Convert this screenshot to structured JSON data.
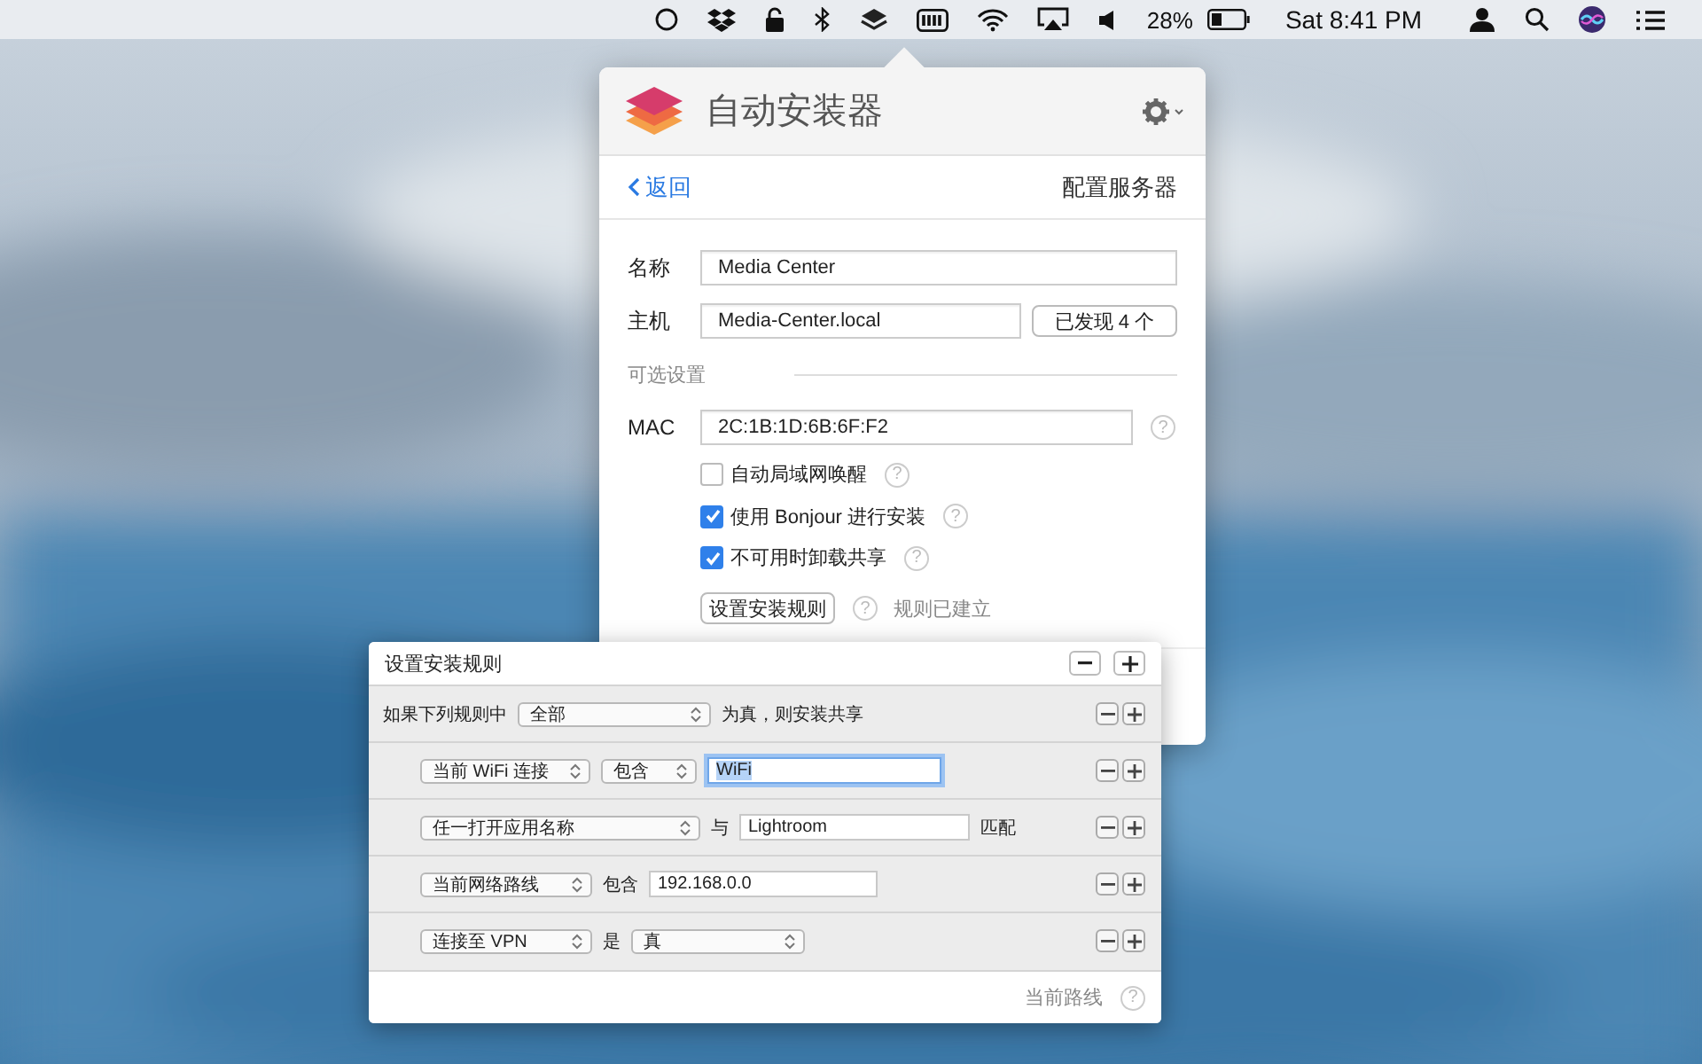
{
  "menubar": {
    "battery": "28%",
    "clock": "Sat 8:41 PM"
  },
  "popover": {
    "title": "自动安装器",
    "back": "返回",
    "heading": "配置服务器",
    "fields": [
      {
        "label": "名称",
        "value": "Media Center"
      },
      {
        "label": "主机",
        "value": "Media-Center.local",
        "button": "已发现 4 个"
      }
    ],
    "section": "可选设置",
    "mac": {
      "label": "MAC",
      "value": "2C:1B:1D:6B:6F:F2",
      "help": "?"
    },
    "options": [
      {
        "label": "自动局域网唤醒",
        "checked": false,
        "help": "?"
      },
      {
        "label": "使用 Bonjour 进行安装",
        "checked": true,
        "help": "?"
      },
      {
        "label": "不可用时卸载共享",
        "checked": true,
        "help": "?"
      }
    ],
    "rules_button": "设置安装规则",
    "rules_help": "?",
    "rules_status": "规则已建立"
  },
  "rules_sheet": {
    "title": "设置安装规则",
    "header": {
      "prefix": "如果下列规则中",
      "popup": "全部",
      "suffix": "为真，则安装共享"
    },
    "rules": [
      {
        "parts": [
          {
            "kind": "popup",
            "text": "当前 WiFi 连接"
          },
          {
            "kind": "popup",
            "text": "包含"
          },
          {
            "kind": "field",
            "text": "WiFi",
            "focused": true
          }
        ]
      },
      {
        "parts": [
          {
            "kind": "popup",
            "text": "任一打开应用名称"
          },
          {
            "kind": "label",
            "text": "与"
          },
          {
            "kind": "field",
            "text": "Lightroom",
            "focused": false
          },
          {
            "kind": "label",
            "text": "匹配"
          }
        ]
      },
      {
        "parts": [
          {
            "kind": "popup",
            "text": "当前网络路线"
          },
          {
            "kind": "label",
            "text": "包含"
          },
          {
            "kind": "field",
            "text": "192.168.0.0",
            "focused": false
          }
        ]
      },
      {
        "parts": [
          {
            "kind": "popup",
            "text": "连接至 VPN"
          },
          {
            "kind": "label",
            "text": "是"
          },
          {
            "kind": "popup",
            "text": "真"
          }
        ]
      }
    ],
    "footer": "当前路线",
    "footer_help": "?"
  }
}
